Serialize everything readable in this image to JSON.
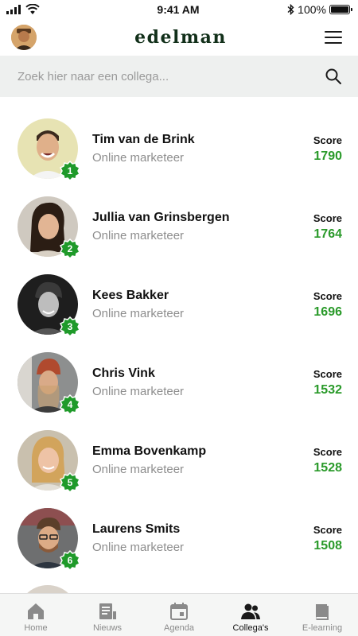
{
  "status_bar": {
    "time": "9:41 AM",
    "battery": "100%"
  },
  "header": {
    "brand": "edelman",
    "menu_icon": "hamburger-menu-icon",
    "avatar_icon": "user-avatar"
  },
  "search": {
    "placeholder": "Zoek hier naar een collega...",
    "value": "",
    "icon": "search-icon"
  },
  "colleagues": [
    {
      "rank": "1",
      "name": "Tim van de Brink",
      "role": "Online marketeer",
      "score_label": "Score",
      "score": "1790"
    },
    {
      "rank": "2",
      "name": "Jullia van Grinsbergen",
      "role": "Online marketeer",
      "score_label": "Score",
      "score": "1764"
    },
    {
      "rank": "3",
      "name": "Kees Bakker",
      "role": "Online marketeer",
      "score_label": "Score",
      "score": "1696"
    },
    {
      "rank": "4",
      "name": "Chris Vink",
      "role": "Online marketeer",
      "score_label": "Score",
      "score": "1532"
    },
    {
      "rank": "5",
      "name": "Emma Bovenkamp",
      "role": "Online marketeer",
      "score_label": "Score",
      "score": "1528"
    },
    {
      "rank": "6",
      "name": "Laurens Smits",
      "role": "Online marketeer",
      "score_label": "Score",
      "score": "1508"
    }
  ],
  "bottom_nav": [
    {
      "label": "Home",
      "icon": "home-icon",
      "active": false
    },
    {
      "label": "Nieuws",
      "icon": "news-icon",
      "active": false
    },
    {
      "label": "Agenda",
      "icon": "calendar-icon",
      "active": false
    },
    {
      "label": "Collega's",
      "icon": "people-icon",
      "active": true
    },
    {
      "label": "E-learning",
      "icon": "book-icon",
      "active": false
    }
  ],
  "colors": {
    "accent_green": "#2a9a2a",
    "badge_green": "#1f9a2a",
    "brand_dark_green": "#12301a",
    "search_bg": "#eef0ef",
    "nav_bg": "#f5f6f5"
  }
}
